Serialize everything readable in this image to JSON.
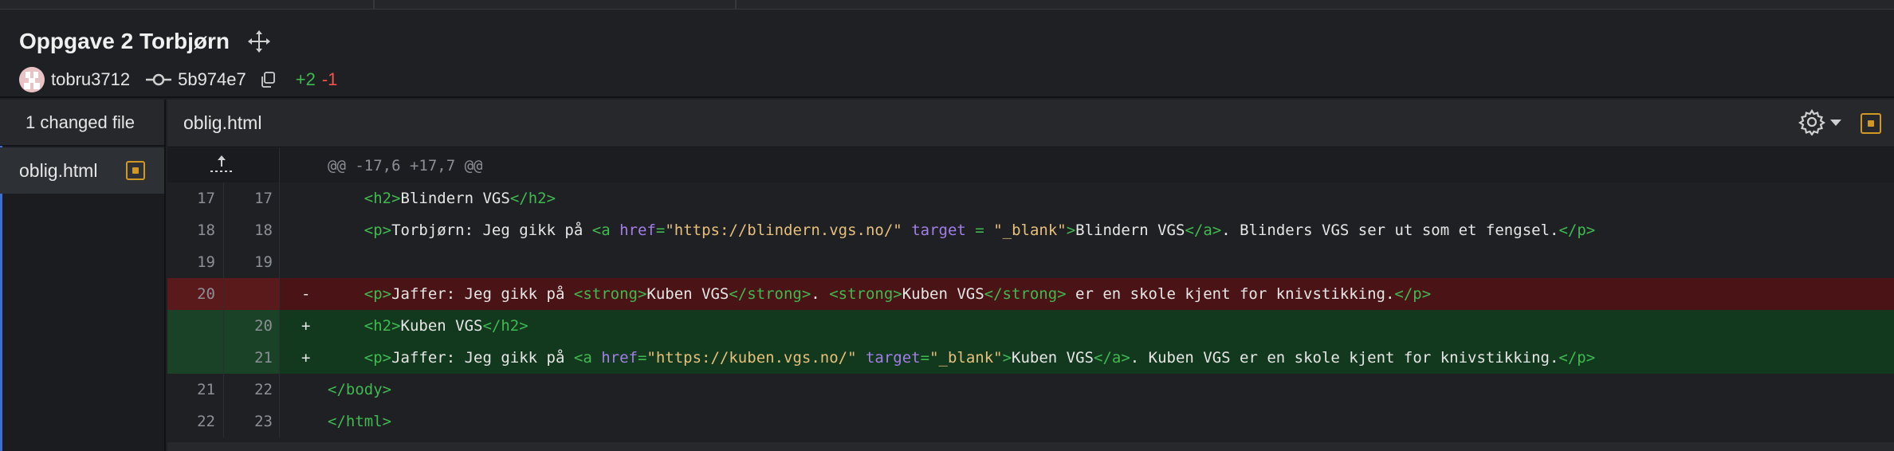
{
  "header": {
    "title": "Oppgave 2 Torbjørn",
    "author": "tobru3712",
    "sha": "5b974e7",
    "additions": "+2",
    "deletions": "-1"
  },
  "icons": {
    "move": "move-icon",
    "commit": "commit-icon",
    "copy": "copy-icon",
    "settings": "gear-icon",
    "expand": "expand-up-icon"
  },
  "colors": {
    "added_bg": "#12381e",
    "deleted_bg": "#4a1416",
    "additions_text": "#3fb950",
    "deletions_text": "#f85149",
    "badge": "#d29922"
  },
  "sidebar": {
    "heading": "1 changed file",
    "files": [
      {
        "label": "oblig.html"
      }
    ]
  },
  "file": {
    "name": "oblig.html"
  },
  "diff": {
    "hunk": "@@ -17,6 +17,7 @@",
    "lines": [
      {
        "old": "17",
        "new": "17",
        "sign": "",
        "parts": [
          [
            "p",
            "    "
          ],
          [
            "t",
            "<h2>"
          ],
          [
            "p",
            "Blindern VGS"
          ],
          [
            "t",
            "</h2>"
          ]
        ]
      },
      {
        "old": "18",
        "new": "18",
        "sign": "",
        "parts": [
          [
            "p",
            "    "
          ],
          [
            "t",
            "<p>"
          ],
          [
            "p",
            "Torbjørn: Jeg gikk på "
          ],
          [
            "t",
            "<a "
          ],
          [
            "a",
            "href"
          ],
          [
            "t",
            "="
          ],
          [
            "s",
            "\"https://blindern.vgs.no/\""
          ],
          [
            "p",
            " "
          ],
          [
            "a",
            "target"
          ],
          [
            "p",
            " "
          ],
          [
            "t",
            "="
          ],
          [
            "p",
            " "
          ],
          [
            "s",
            "\"_blank\""
          ],
          [
            "t",
            ">"
          ],
          [
            "p",
            "Blindern VGS"
          ],
          [
            "t",
            "</a>"
          ],
          [
            "p",
            ". Blinders VGS ser ut som et fengsel."
          ],
          [
            "t",
            "</p>"
          ]
        ]
      },
      {
        "old": "19",
        "new": "19",
        "sign": "",
        "parts": []
      },
      {
        "old": "20",
        "new": "",
        "sign": "-",
        "parts": [
          [
            "p",
            "    "
          ],
          [
            "t",
            "<p>"
          ],
          [
            "p",
            "Jaffer: Jeg gikk på "
          ],
          [
            "t",
            "<strong>"
          ],
          [
            "p",
            "Kuben VGS"
          ],
          [
            "t",
            "</strong>"
          ],
          [
            "p",
            ". "
          ],
          [
            "t",
            "<strong>"
          ],
          [
            "p",
            "Kuben VGS"
          ],
          [
            "t",
            "</strong>"
          ],
          [
            "p",
            " er en skole kjent for knivstikking."
          ],
          [
            "t",
            "</p>"
          ]
        ]
      },
      {
        "old": "",
        "new": "20",
        "sign": "+",
        "parts": [
          [
            "p",
            "    "
          ],
          [
            "t",
            "<h2>"
          ],
          [
            "p",
            "Kuben VGS"
          ],
          [
            "t",
            "</h2>"
          ]
        ]
      },
      {
        "old": "",
        "new": "21",
        "sign": "+",
        "parts": [
          [
            "p",
            "    "
          ],
          [
            "t",
            "<p>"
          ],
          [
            "p",
            "Jaffer: Jeg gikk på "
          ],
          [
            "t",
            "<a "
          ],
          [
            "a",
            "href"
          ],
          [
            "t",
            "="
          ],
          [
            "s",
            "\"https://kuben.vgs.no/\""
          ],
          [
            "p",
            " "
          ],
          [
            "a",
            "target"
          ],
          [
            "t",
            "="
          ],
          [
            "s",
            "\"_blank\""
          ],
          [
            "t",
            ">"
          ],
          [
            "p",
            "Kuben VGS"
          ],
          [
            "t",
            "</a>"
          ],
          [
            "p",
            ". Kuben VGS er en skole kjent for knivstikking."
          ],
          [
            "t",
            "</p>"
          ]
        ]
      },
      {
        "old": "21",
        "new": "22",
        "sign": "",
        "parts": [
          [
            "t",
            "</body>"
          ]
        ]
      },
      {
        "old": "22",
        "new": "23",
        "sign": "",
        "parts": [
          [
            "t",
            "</html>"
          ]
        ]
      }
    ]
  }
}
